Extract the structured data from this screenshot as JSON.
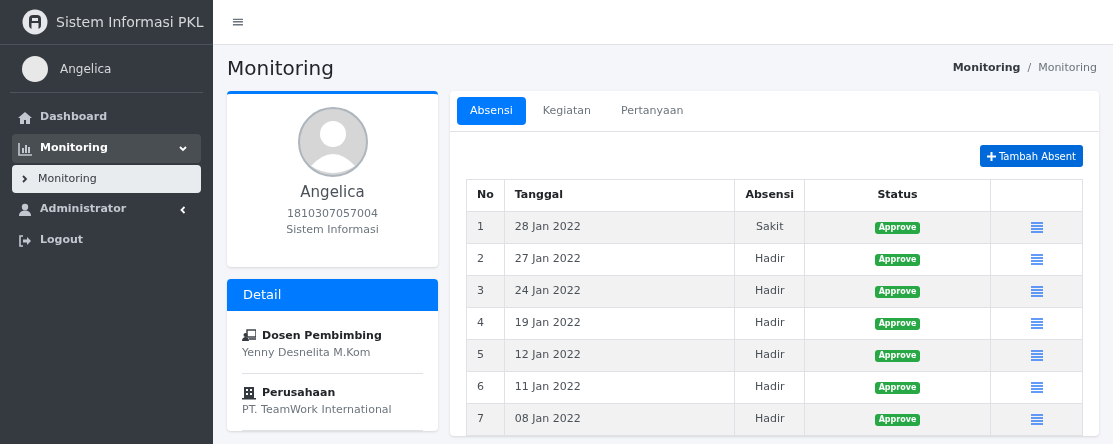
{
  "brand": {
    "title": "Sistem Informasi PKL"
  },
  "user": {
    "name": "Angelica"
  },
  "sidebar": {
    "items": [
      {
        "label": "Dashboard",
        "selected": false
      },
      {
        "label": "Monitoring",
        "selected": true,
        "expanded": true,
        "children": [
          {
            "label": "Monitoring",
            "selected": true
          }
        ]
      },
      {
        "label": "Administrator",
        "selected": false,
        "expanded": false
      },
      {
        "label": "Logout",
        "selected": false
      }
    ]
  },
  "topbar": {
    "menu_icon": "≡"
  },
  "page": {
    "title": "Monitoring",
    "breadcrumb": [
      {
        "label": "Monitoring",
        "current": false
      },
      {
        "label": "Monitoring",
        "current": true
      }
    ],
    "breadcrumb_separator": "/"
  },
  "profile": {
    "name": "Angelica",
    "id_number": "1810307057004",
    "program": "Sistem Informasi"
  },
  "detail": {
    "title": "Detail",
    "items": [
      {
        "label": "Dosen Pembimbing",
        "value": "Yenny Desnelita M.Kom"
      },
      {
        "label": "Perusahaan",
        "value": "PT. TeamWork International"
      }
    ]
  },
  "tabs": [
    {
      "label": "Absensi",
      "selected": true
    },
    {
      "label": "Kegiatan",
      "selected": false
    },
    {
      "label": "Pertanyaan",
      "selected": false
    }
  ],
  "add_button": {
    "label": "Tambah Absent"
  },
  "table": {
    "columns": [
      "No",
      "Tanggal",
      "Absensi",
      "Status"
    ],
    "rows": [
      {
        "no": "1",
        "date": "28 Jan 2022",
        "attendance": "Sakit",
        "status": "Approve"
      },
      {
        "no": "2",
        "date": "27 Jan 2022",
        "attendance": "Hadir",
        "status": "Approve"
      },
      {
        "no": "3",
        "date": "24 Jan 2022",
        "attendance": "Hadir",
        "status": "Approve"
      },
      {
        "no": "4",
        "date": "19 Jan 2022",
        "attendance": "Hadir",
        "status": "Approve"
      },
      {
        "no": "5",
        "date": "12 Jan 2022",
        "attendance": "Hadir",
        "status": "Approve"
      },
      {
        "no": "6",
        "date": "11 Jan 2022",
        "attendance": "Hadir",
        "status": "Approve"
      },
      {
        "no": "7",
        "date": "08 Jan 2022",
        "attendance": "Hadir",
        "status": "Approve"
      }
    ]
  }
}
